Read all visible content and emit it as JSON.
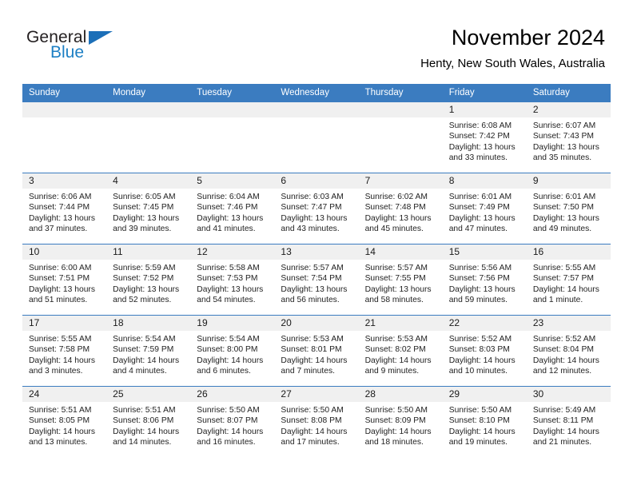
{
  "brand": {
    "name_part1": "General",
    "name_part2": "Blue",
    "triangle_color": "#1c6fb8",
    "blue_color": "#1c7fc4"
  },
  "header": {
    "title": "November 2024",
    "subtitle": "Henty, New South Wales, Australia"
  },
  "theme": {
    "header_blue": "#3b7cc0",
    "daynum_band": "#f0f0f0",
    "text": "#222222"
  },
  "calendar": {
    "weekday_headers": [
      "Sunday",
      "Monday",
      "Tuesday",
      "Wednesday",
      "Thursday",
      "Friday",
      "Saturday"
    ],
    "labels": {
      "sunrise": "Sunrise:",
      "sunset": "Sunset:",
      "daylight": "Daylight:"
    },
    "weeks": [
      [
        {
          "day": "",
          "empty": true,
          "sunrise": "",
          "sunset": "",
          "daylight": ""
        },
        {
          "day": "",
          "empty": true,
          "sunrise": "",
          "sunset": "",
          "daylight": ""
        },
        {
          "day": "",
          "empty": true,
          "sunrise": "",
          "sunset": "",
          "daylight": ""
        },
        {
          "day": "",
          "empty": true,
          "sunrise": "",
          "sunset": "",
          "daylight": ""
        },
        {
          "day": "",
          "empty": true,
          "sunrise": "",
          "sunset": "",
          "daylight": ""
        },
        {
          "day": "1",
          "empty": false,
          "sunrise": "Sunrise: 6:08 AM",
          "sunset": "Sunset: 7:42 PM",
          "daylight": "Daylight: 13 hours and 33 minutes."
        },
        {
          "day": "2",
          "empty": false,
          "sunrise": "Sunrise: 6:07 AM",
          "sunset": "Sunset: 7:43 PM",
          "daylight": "Daylight: 13 hours and 35 minutes."
        }
      ],
      [
        {
          "day": "3",
          "empty": false,
          "sunrise": "Sunrise: 6:06 AM",
          "sunset": "Sunset: 7:44 PM",
          "daylight": "Daylight: 13 hours and 37 minutes."
        },
        {
          "day": "4",
          "empty": false,
          "sunrise": "Sunrise: 6:05 AM",
          "sunset": "Sunset: 7:45 PM",
          "daylight": "Daylight: 13 hours and 39 minutes."
        },
        {
          "day": "5",
          "empty": false,
          "sunrise": "Sunrise: 6:04 AM",
          "sunset": "Sunset: 7:46 PM",
          "daylight": "Daylight: 13 hours and 41 minutes."
        },
        {
          "day": "6",
          "empty": false,
          "sunrise": "Sunrise: 6:03 AM",
          "sunset": "Sunset: 7:47 PM",
          "daylight": "Daylight: 13 hours and 43 minutes."
        },
        {
          "day": "7",
          "empty": false,
          "sunrise": "Sunrise: 6:02 AM",
          "sunset": "Sunset: 7:48 PM",
          "daylight": "Daylight: 13 hours and 45 minutes."
        },
        {
          "day": "8",
          "empty": false,
          "sunrise": "Sunrise: 6:01 AM",
          "sunset": "Sunset: 7:49 PM",
          "daylight": "Daylight: 13 hours and 47 minutes."
        },
        {
          "day": "9",
          "empty": false,
          "sunrise": "Sunrise: 6:01 AM",
          "sunset": "Sunset: 7:50 PM",
          "daylight": "Daylight: 13 hours and 49 minutes."
        }
      ],
      [
        {
          "day": "10",
          "empty": false,
          "sunrise": "Sunrise: 6:00 AM",
          "sunset": "Sunset: 7:51 PM",
          "daylight": "Daylight: 13 hours and 51 minutes."
        },
        {
          "day": "11",
          "empty": false,
          "sunrise": "Sunrise: 5:59 AM",
          "sunset": "Sunset: 7:52 PM",
          "daylight": "Daylight: 13 hours and 52 minutes."
        },
        {
          "day": "12",
          "empty": false,
          "sunrise": "Sunrise: 5:58 AM",
          "sunset": "Sunset: 7:53 PM",
          "daylight": "Daylight: 13 hours and 54 minutes."
        },
        {
          "day": "13",
          "empty": false,
          "sunrise": "Sunrise: 5:57 AM",
          "sunset": "Sunset: 7:54 PM",
          "daylight": "Daylight: 13 hours and 56 minutes."
        },
        {
          "day": "14",
          "empty": false,
          "sunrise": "Sunrise: 5:57 AM",
          "sunset": "Sunset: 7:55 PM",
          "daylight": "Daylight: 13 hours and 58 minutes."
        },
        {
          "day": "15",
          "empty": false,
          "sunrise": "Sunrise: 5:56 AM",
          "sunset": "Sunset: 7:56 PM",
          "daylight": "Daylight: 13 hours and 59 minutes."
        },
        {
          "day": "16",
          "empty": false,
          "sunrise": "Sunrise: 5:55 AM",
          "sunset": "Sunset: 7:57 PM",
          "daylight": "Daylight: 14 hours and 1 minute."
        }
      ],
      [
        {
          "day": "17",
          "empty": false,
          "sunrise": "Sunrise: 5:55 AM",
          "sunset": "Sunset: 7:58 PM",
          "daylight": "Daylight: 14 hours and 3 minutes."
        },
        {
          "day": "18",
          "empty": false,
          "sunrise": "Sunrise: 5:54 AM",
          "sunset": "Sunset: 7:59 PM",
          "daylight": "Daylight: 14 hours and 4 minutes."
        },
        {
          "day": "19",
          "empty": false,
          "sunrise": "Sunrise: 5:54 AM",
          "sunset": "Sunset: 8:00 PM",
          "daylight": "Daylight: 14 hours and 6 minutes."
        },
        {
          "day": "20",
          "empty": false,
          "sunrise": "Sunrise: 5:53 AM",
          "sunset": "Sunset: 8:01 PM",
          "daylight": "Daylight: 14 hours and 7 minutes."
        },
        {
          "day": "21",
          "empty": false,
          "sunrise": "Sunrise: 5:53 AM",
          "sunset": "Sunset: 8:02 PM",
          "daylight": "Daylight: 14 hours and 9 minutes."
        },
        {
          "day": "22",
          "empty": false,
          "sunrise": "Sunrise: 5:52 AM",
          "sunset": "Sunset: 8:03 PM",
          "daylight": "Daylight: 14 hours and 10 minutes."
        },
        {
          "day": "23",
          "empty": false,
          "sunrise": "Sunrise: 5:52 AM",
          "sunset": "Sunset: 8:04 PM",
          "daylight": "Daylight: 14 hours and 12 minutes."
        }
      ],
      [
        {
          "day": "24",
          "empty": false,
          "sunrise": "Sunrise: 5:51 AM",
          "sunset": "Sunset: 8:05 PM",
          "daylight": "Daylight: 14 hours and 13 minutes."
        },
        {
          "day": "25",
          "empty": false,
          "sunrise": "Sunrise: 5:51 AM",
          "sunset": "Sunset: 8:06 PM",
          "daylight": "Daylight: 14 hours and 14 minutes."
        },
        {
          "day": "26",
          "empty": false,
          "sunrise": "Sunrise: 5:50 AM",
          "sunset": "Sunset: 8:07 PM",
          "daylight": "Daylight: 14 hours and 16 minutes."
        },
        {
          "day": "27",
          "empty": false,
          "sunrise": "Sunrise: 5:50 AM",
          "sunset": "Sunset: 8:08 PM",
          "daylight": "Daylight: 14 hours and 17 minutes."
        },
        {
          "day": "28",
          "empty": false,
          "sunrise": "Sunrise: 5:50 AM",
          "sunset": "Sunset: 8:09 PM",
          "daylight": "Daylight: 14 hours and 18 minutes."
        },
        {
          "day": "29",
          "empty": false,
          "sunrise": "Sunrise: 5:50 AM",
          "sunset": "Sunset: 8:10 PM",
          "daylight": "Daylight: 14 hours and 19 minutes."
        },
        {
          "day": "30",
          "empty": false,
          "sunrise": "Sunrise: 5:49 AM",
          "sunset": "Sunset: 8:11 PM",
          "daylight": "Daylight: 14 hours and 21 minutes."
        }
      ]
    ]
  }
}
